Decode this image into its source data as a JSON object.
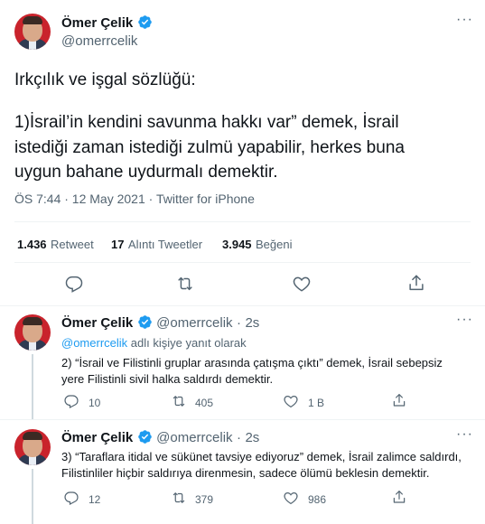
{
  "main_tweet": {
    "author_name": "Ömer Çelik",
    "author_handle": "@omerrcelik",
    "text_line1": "Irkçılık ve işgal sözlüğü:",
    "text_line2": "1)İsrail’in kendini savunma hakkı var” demek, İsrail",
    "text_line3": "istediği zaman istediği zulmü yapabilir, herkes buna",
    "text_line4": "uygun bahane uydurmalı demektir.",
    "timestamp": "ÖS 7:44 · 12 May 2021 · Twitter for iPhone",
    "retweets_count": "1.436",
    "retweets_label": "Retweet",
    "quotes_count": "17",
    "quotes_label": "Alıntı Tweetler",
    "likes_count": "3.945",
    "likes_label": "Beğeni"
  },
  "reply1": {
    "author_name": "Ömer Çelik",
    "author_handle": "@omerrcelik",
    "time": "2s",
    "reply_to_handle": "@omerrcelik",
    "reply_to_suffix": " adlı kişiye yanıt olarak",
    "text_line1": "2) “İsrail ve Filistinli gruplar arasında çatışma çıktı” demek, İsrail sebepsiz",
    "text_line2": "yere Filistinli sivil halka saldırdı demektir.",
    "replies": "10",
    "retweets": "405",
    "likes": "1 B"
  },
  "reply2": {
    "author_name": "Ömer Çelik",
    "author_handle": "@omerrcelik",
    "time": "2s",
    "text_line1": "3) “Taraflara itidal ve sükünet tavsiye ediyoruz” demek, İsrail zalimce saldırdı,",
    "text_line2": "Filistinliler hiçbir saldırıya direnmesin, sadece ölümü beklesin demektir.",
    "replies": "12",
    "retweets": "379",
    "likes": "986"
  },
  "colors": {
    "accent": "#1d9bf0",
    "text": "#0f1419",
    "muted": "#536471",
    "divider": "#eff3f4"
  },
  "icons": [
    "verified-badge-icon",
    "more-icon",
    "reply-icon",
    "retweet-icon",
    "like-icon",
    "share-icon"
  ]
}
